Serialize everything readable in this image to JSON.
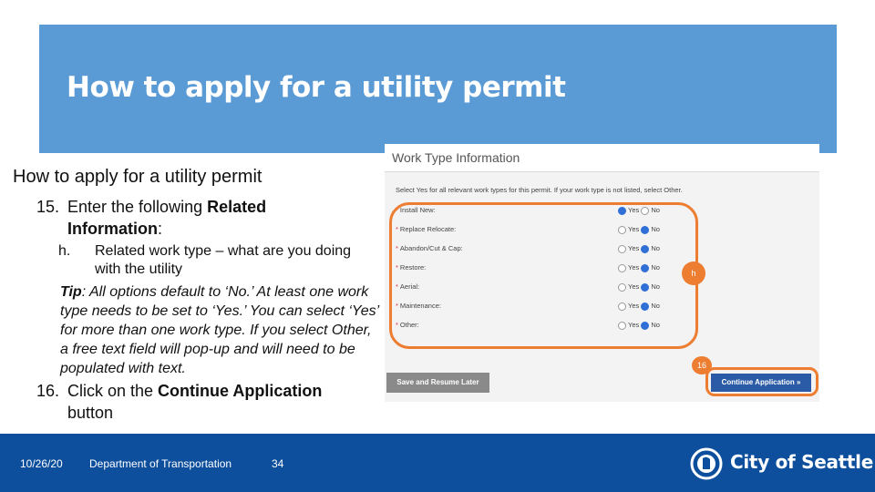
{
  "banner": {
    "title": "How to apply for a utility permit"
  },
  "content": {
    "subtitle": "How to apply for a utility permit",
    "step15": {
      "num": "15.",
      "text_a": "Enter the following ",
      "bold_a": "Related",
      "bold_b": "Information",
      "text_b": ":"
    },
    "sub_h": {
      "letter": "h.",
      "text": "Related work type – what are you doing with the utility"
    },
    "tip": {
      "label": "Tip",
      "text": ": All options default to ‘No.’ At least one work type needs to be set to ‘Yes.’ You can select ‘Yes’ for more than one work type. If you select Other, a free text field will pop-up and will need to be populated with text."
    },
    "step16": {
      "num": "16.",
      "text_a": "Click on the ",
      "bold": "Continue Application",
      "text_b": "button"
    }
  },
  "screenshot": {
    "header": "Work Type Information",
    "instruction": "Select Yes for all relevant work types for this permit. If your work type is not listed, select Other.",
    "yes_label": "Yes",
    "no_label": "No",
    "rows": [
      {
        "label": "Install New:",
        "selected": "Yes"
      },
      {
        "label": "Replace Relocate:",
        "selected": "No"
      },
      {
        "label": "Abandon/Cut & Cap:",
        "selected": "No"
      },
      {
        "label": "Restore:",
        "selected": "No"
      },
      {
        "label": "Aerial:",
        "selected": "No"
      },
      {
        "label": "Maintenance:",
        "selected": "No"
      },
      {
        "label": "Other:",
        "selected": "No"
      }
    ],
    "save_button": "Save and Resume Later",
    "continue_button": "Continue Application »"
  },
  "callouts": {
    "h": "h",
    "s16": "16"
  },
  "colors": {
    "banner": "#5b9bd5",
    "callout": "#ed7d31",
    "footer": "#0d4f9d"
  },
  "footer": {
    "date": "10/26/20",
    "department": "Department of Transportation",
    "page": "34",
    "logo_text": "City of Seattle"
  }
}
